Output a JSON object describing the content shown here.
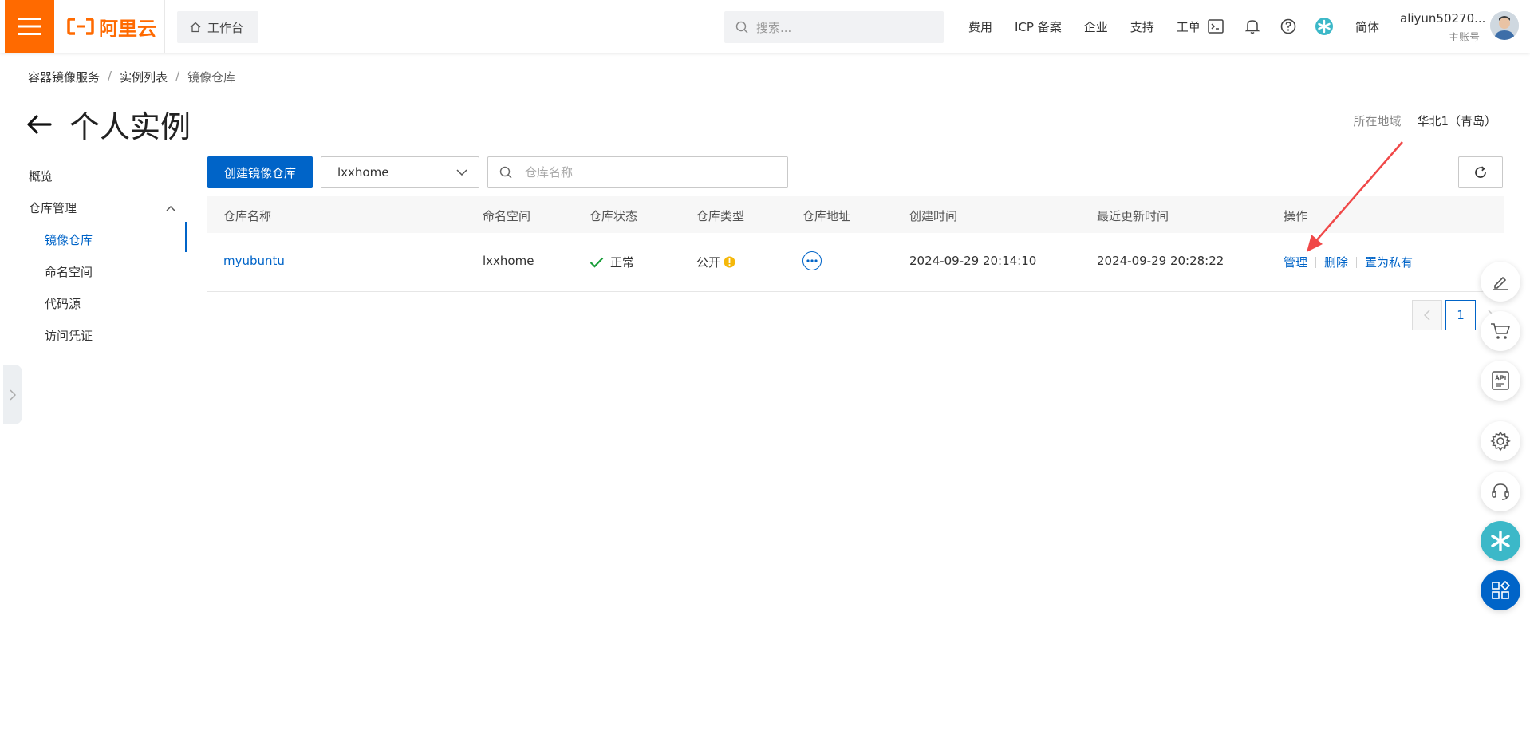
{
  "topbar": {
    "brand": "阿里云",
    "workbench": "工作台",
    "search_placeholder": "搜索...",
    "links": [
      "费用",
      "ICP 备案",
      "企业",
      "支持",
      "工单"
    ],
    "lang": "简体",
    "account_name": "aliyun50270...",
    "account_type": "主账号"
  },
  "breadcrumb": [
    "容器镜像服务",
    "实例列表",
    "镜像仓库"
  ],
  "page": {
    "title": "个人实例",
    "region_label": "所在地域",
    "region_value": "华北1（青岛）"
  },
  "sidebar": {
    "overview": "概览",
    "group": "仓库管理",
    "items": [
      "镜像仓库",
      "命名空间",
      "代码源",
      "访问凭证"
    ]
  },
  "toolbar": {
    "create_label": "创建镜像仓库",
    "namespace_value": "lxxhome",
    "repo_search_placeholder": "仓库名称"
  },
  "table": {
    "headers": [
      "仓库名称",
      "命名空间",
      "仓库状态",
      "仓库类型",
      "仓库地址",
      "创建时间",
      "最近更新时间",
      "操作"
    ],
    "rows": [
      {
        "name": "myubuntu",
        "namespace": "lxxhome",
        "status": "正常",
        "type": "公开",
        "created": "2024-09-29 20:14:10",
        "updated": "2024-09-29 20:28:22",
        "actions": [
          "管理",
          "删除",
          "置为私有"
        ]
      }
    ]
  },
  "pagination": {
    "current": "1"
  },
  "colors": {
    "brand": "#ff6a00",
    "primary": "#0064c8",
    "success": "#1a9e3a",
    "warning": "#f5b80a",
    "annotation": "#f04848"
  }
}
